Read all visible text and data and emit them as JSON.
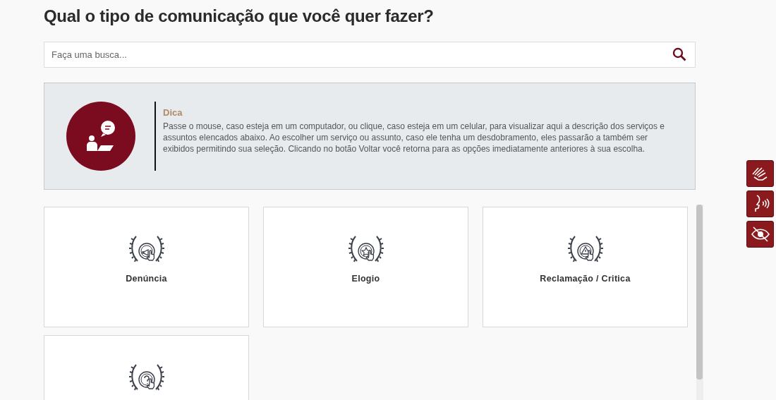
{
  "heading": "Qual o tipo de comunicação que você quer fazer?",
  "search": {
    "placeholder": "Faça uma busca..."
  },
  "tip": {
    "title": "Dica",
    "text": "Passe o mouse, caso esteja em um computador, ou clique, caso esteja em um celular, para visualizar aqui a descrição dos serviços e assuntos elencados abaixo. Ao escolher um serviço ou assunto, caso ele tenha um desdobramento, eles passarão a também ser exibidos permitindo sua seleção. Clicando no botão Voltar você retorna para as opções imediatamente anteriores à sua escolha."
  },
  "options": [
    {
      "kind": "megaphone",
      "label": "Denúncia"
    },
    {
      "kind": "star",
      "label": "Elogio"
    },
    {
      "kind": "warning",
      "label": "Reclamação / Critica"
    },
    {
      "kind": "question"
    }
  ],
  "accessibility": [
    {
      "kind": "sign-language"
    },
    {
      "kind": "voice"
    },
    {
      "kind": "contrast"
    }
  ]
}
